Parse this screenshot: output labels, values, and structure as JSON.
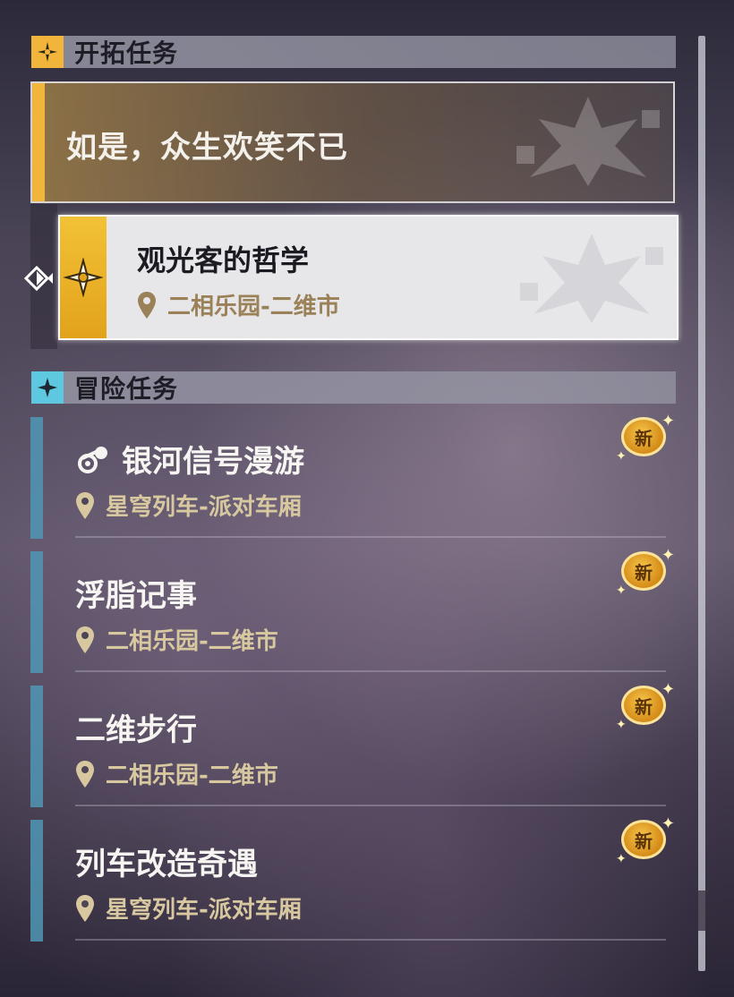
{
  "trailblaze": {
    "header": "开拓任务",
    "quest_title": "如是，众生欢笑不已",
    "active": {
      "title": "观光客的哲学",
      "location": "二相乐园-二维市"
    }
  },
  "adventure": {
    "header": "冒险任务",
    "new_label": "新",
    "items": [
      {
        "title": "银河信号漫游",
        "location": "星穹列车-派对车厢"
      },
      {
        "title": "浮脂记事",
        "location": "二相乐园-二维市"
      },
      {
        "title": "二维步行",
        "location": "二相乐园-二维市"
      },
      {
        "title": "列车改造奇遇",
        "location": "星穹列车-派对车厢"
      }
    ]
  },
  "colors": {
    "trailblaze_accent": "#f0b53a",
    "adventure_accent": "#5096b4",
    "location_text": "#d8c8a0",
    "new_badge": "#e8a728"
  },
  "icons": {
    "trailblaze": "trailblaze-star-icon",
    "adventure": "adventure-sparkle-icon",
    "pointer": "selection-pointer-icon",
    "location": "location-pin-icon",
    "game": "game-controller-icon"
  }
}
